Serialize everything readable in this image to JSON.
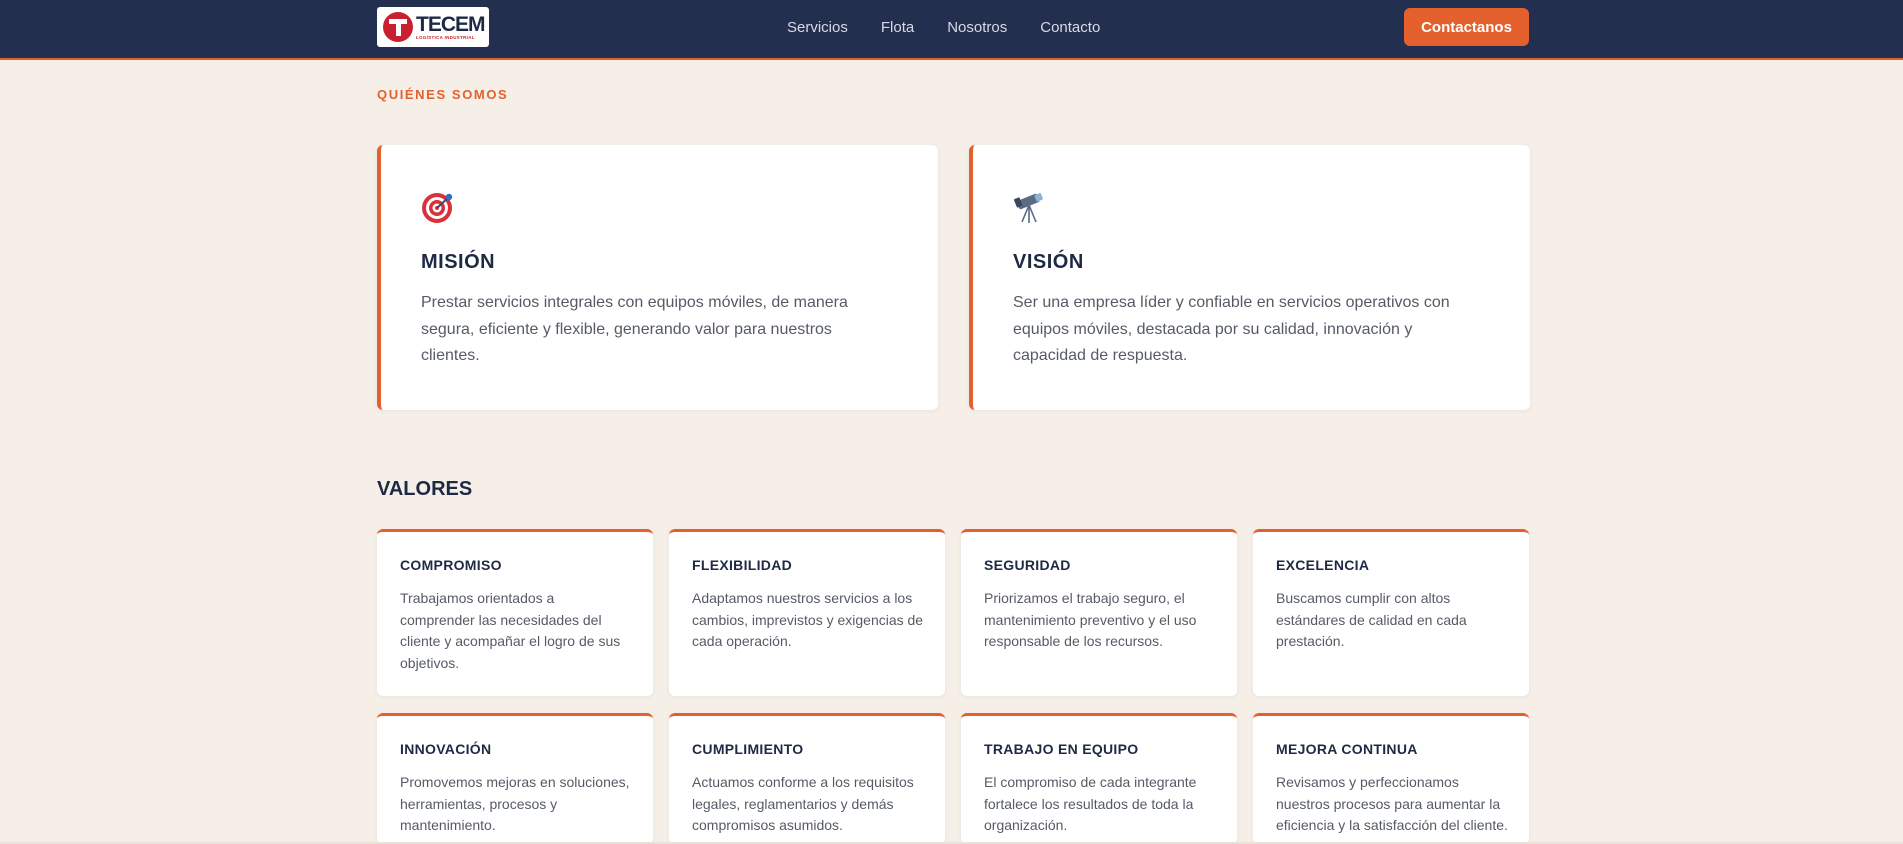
{
  "header": {
    "logo_text": "TECEM",
    "logo_subtext": "LOGÍSTICA INDUSTRIAL",
    "nav": [
      "Servicios",
      "Flota",
      "Nosotros",
      "Contacto"
    ],
    "cta_label": "Contactanos"
  },
  "about": {
    "eyebrow": "QUIÉNES SOMOS",
    "mision": {
      "icon": "target-icon",
      "title": "MISIÓN",
      "text": "Prestar servicios integrales con equipos móviles, de manera segura, eficiente y flexible, generando valor para nuestros clientes."
    },
    "vision": {
      "icon": "telescope-icon",
      "title": "VISIÓN",
      "text": "Ser una empresa líder y confiable en servicios operativos con equipos móviles, destacada por su calidad, innovación y capacidad de respuesta."
    }
  },
  "values": {
    "title": "VALORES",
    "items": [
      {
        "title": "COMPROMISO",
        "text": "Trabajamos orientados a comprender las necesidades del cliente y acompañar el logro de sus objetivos."
      },
      {
        "title": "FLEXIBILIDAD",
        "text": "Adaptamos nuestros servicios a los cambios, imprevistos y exigencias de cada operación."
      },
      {
        "title": "SEGURIDAD",
        "text": "Priorizamos el trabajo seguro, el mantenimiento preventivo y el uso responsable de los recursos."
      },
      {
        "title": "EXCELENCIA",
        "text": "Buscamos cumplir con altos estándares de calidad en cada prestación."
      },
      {
        "title": "INNOVACIÓN",
        "text": "Promovemos mejoras en soluciones, herramientas, procesos y mantenimiento."
      },
      {
        "title": "CUMPLIMIENTO",
        "text": "Actuamos conforme a los requisitos legales, reglamentarios y demás compromisos asumidos."
      },
      {
        "title": "TRABAJO EN EQUIPO",
        "text": "El compromiso de cada integrante fortalece los resultados de toda la organización."
      },
      {
        "title": "MEJORA CONTINUA",
        "text": "Revisamos y perfeccionamos nuestros procesos para aumentar la eficiencia y la satisfacción del cliente."
      }
    ]
  },
  "colors": {
    "navy": "#232f4e",
    "accent": "#e4612e",
    "background": "#f5efe8",
    "card": "#ffffff"
  }
}
